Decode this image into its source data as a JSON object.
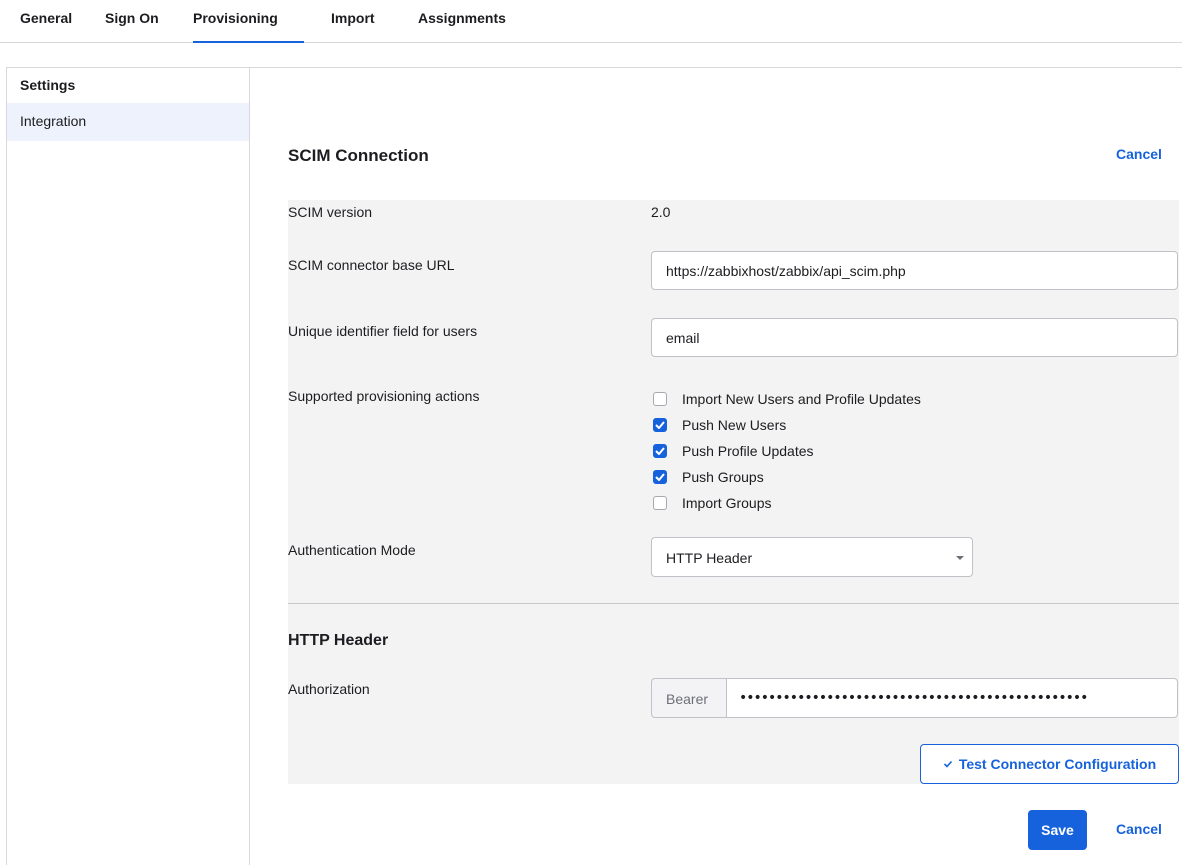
{
  "tabs": [
    {
      "label": "General"
    },
    {
      "label": "Sign On"
    },
    {
      "label": "Provisioning",
      "active": true
    },
    {
      "label": "Import"
    },
    {
      "label": "Assignments"
    }
  ],
  "sidebar": {
    "title": "Settings",
    "items": [
      {
        "label": "Integration",
        "selected": true
      }
    ]
  },
  "section": {
    "title": "SCIM Connection",
    "cancel_label": "Cancel"
  },
  "form": {
    "scim_version": {
      "label": "SCIM version",
      "value": "2.0"
    },
    "base_url": {
      "label": "SCIM connector base URL",
      "value": "https://zabbixhost/zabbix/api_scim.php"
    },
    "unique_id": {
      "label": "Unique identifier field for users",
      "value": "email"
    },
    "actions": {
      "label": "Supported provisioning actions",
      "options": [
        {
          "label": "Import New Users and Profile Updates",
          "checked": false
        },
        {
          "label": "Push New Users",
          "checked": true
        },
        {
          "label": "Push Profile Updates",
          "checked": true
        },
        {
          "label": "Push Groups",
          "checked": true
        },
        {
          "label": "Import Groups",
          "checked": false
        }
      ]
    },
    "auth_mode": {
      "label": "Authentication Mode",
      "value": "HTTP Header"
    }
  },
  "http_header": {
    "title": "HTTP Header",
    "authorization": {
      "label": "Authorization",
      "prefix": "Bearer",
      "value": "••••••••••••••••••••••••••••••••••••••••••••••••"
    },
    "test_button": "Test Connector Configuration"
  },
  "footer": {
    "save_label": "Save",
    "cancel_label": "Cancel"
  },
  "colors": {
    "accent": "#1662dd",
    "panel_bg": "#f3f3f3",
    "selected_bg": "#eef2fc"
  }
}
